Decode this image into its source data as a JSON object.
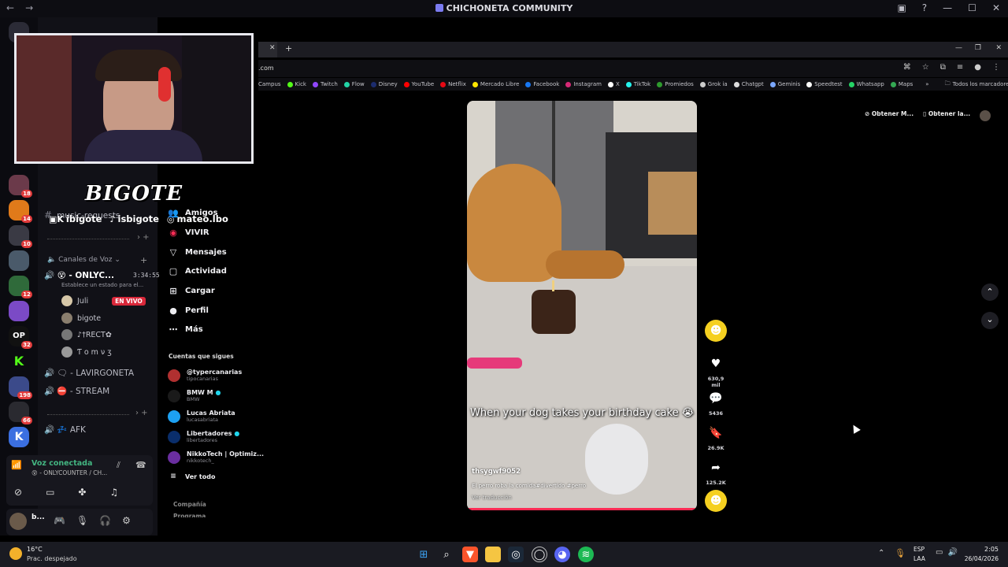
{
  "window": {
    "title": "CHICHONETA COMMUNITY",
    "server_name_partial": "CHICHONETA CO"
  },
  "rail": {
    "badges": [
      "18",
      "14",
      "10",
      "12",
      "32",
      "198",
      "66"
    ]
  },
  "channels": {
    "music_requests": "music-requests",
    "voice_section": "Canales de Voz",
    "vc1": {
      "name": "- ONLYC...",
      "time": "3:34:55",
      "status": "Establece un estado para el..."
    },
    "members": [
      {
        "name": "Juli",
        "live": "EN VIVO"
      },
      {
        "name": "bigote"
      },
      {
        "name": "♪†RECT✿"
      },
      {
        "name": "Ƭ o m ν ʒ"
      }
    ],
    "vc2": "- LAVIRGONETA",
    "vc3": "- STREAM",
    "afk": "AFK"
  },
  "voice_panel": {
    "title": "Voz conectada",
    "channel": "- ONLYCOUNTER / CH..."
  },
  "user_panel": {
    "name": "b..."
  },
  "webcam": {
    "logo": "BIGOTE",
    "twitch_kick": "ibigote",
    "tiktok": "isbigote",
    "instagram": "mateo.lbo"
  },
  "browser": {
    "url_partial": ".com",
    "bookmarks": [
      "Campus",
      "Kick",
      "Twitch",
      "Flow",
      "Disney",
      "YouTube",
      "Netflix",
      "Mercado Libre",
      "Facebook",
      "Instagram",
      "X",
      "TikTok",
      "Promiedos",
      "Grok ia",
      "Chatgpt",
      "Geminis",
      "Speedtest",
      "Whatsapp",
      "Maps"
    ],
    "all_bookmarks": "Todos los marcadores",
    "get_app_1": "Obtener M...",
    "get_app_2": "Obtener la..."
  },
  "tiktok": {
    "nav": [
      "Amigos",
      "VIVIR",
      "Mensajes",
      "Actividad",
      "Cargar",
      "Perfil",
      "Más"
    ],
    "following_title": "Cuentas que sigues",
    "following": [
      {
        "name": "@typercanarias",
        "handle": "tipocanarias"
      },
      {
        "name": "BMW M",
        "handle": "BMW"
      },
      {
        "name": "Lucas Abriata",
        "handle": "lucasabriata"
      },
      {
        "name": "Libertadores",
        "handle": "libertadores"
      },
      {
        "name": "NikkoTech | Optimiz...",
        "handle": "nikkotech_"
      }
    ],
    "see_all": "Ver todo",
    "footer_1": "Compañía",
    "footer_2": "Programa",
    "video": {
      "caption": "When your dog takes your birthday cake 😭",
      "author": "thsygwf9052",
      "description": "El perro roba la comida#divertido #perro",
      "translate": "Ver traducción",
      "progress": 1.0
    },
    "likes": "630,9 mil",
    "comments": "5436",
    "saves": "26.9K",
    "shares": "125.2K"
  },
  "taskbar": {
    "weather_temp": "16°C",
    "weather_desc": "Prac. despejado",
    "lang": "ESP",
    "lang2": "LAA",
    "time": "2:05",
    "date": "26/04/2026"
  }
}
